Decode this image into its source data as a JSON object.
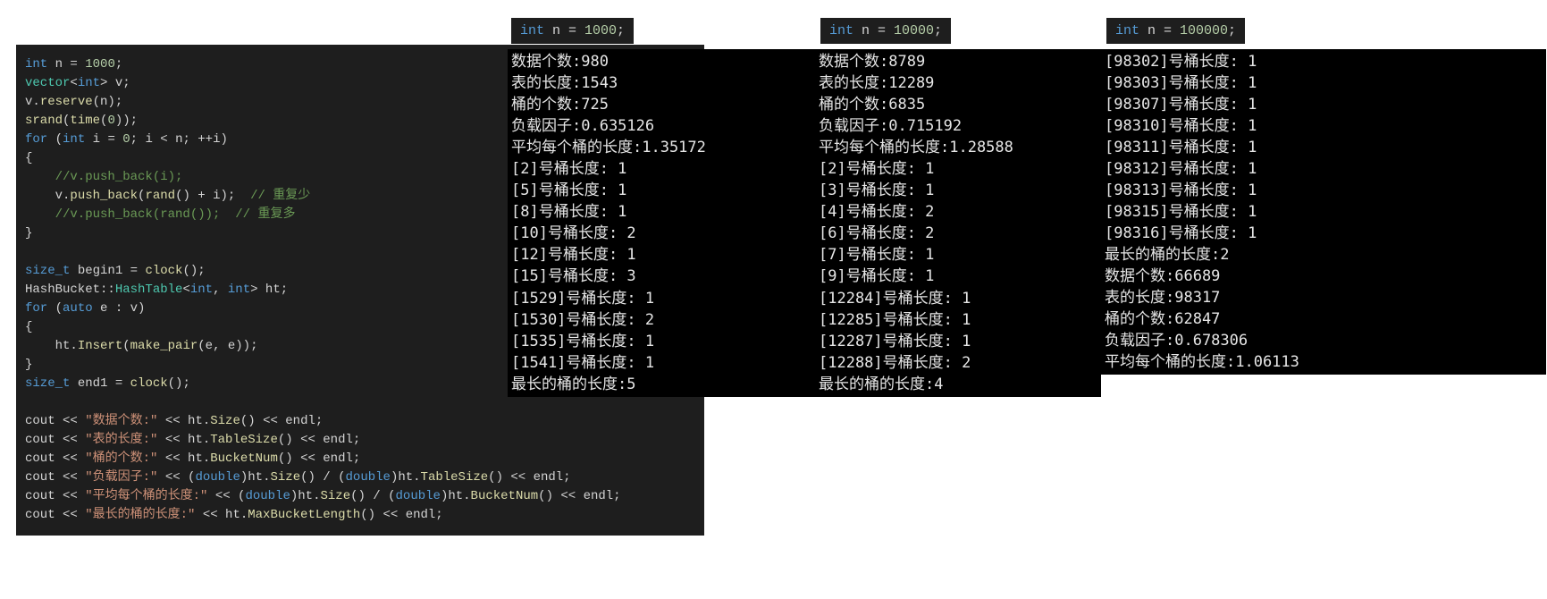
{
  "code": {
    "l1_kw": "int",
    "l1_rest": " n = ",
    "l1_num": "1000",
    "l1_semi": ";",
    "l2_a": "vector",
    "l2_b": "<",
    "l2_c": "int",
    "l2_d": "> v;",
    "l3": "v.reserve(n);",
    "l3_v": "v",
    "l3_dot": ".",
    "l3_fn": "reserve",
    "l3_args": "(n);",
    "l4_fn": "srand",
    "l4_args": "(",
    "l4_fn2": "time",
    "l4_args2": "(",
    "l4_num": "0",
    "l4_end": "));",
    "l5_for": "for",
    "l5_a": " (",
    "l5_int": "int",
    "l5_b": " i = ",
    "l5_z": "0",
    "l5_c": "; i < n; ++i)",
    "l6": "{",
    "l7_cm": "    //v.push_back(i);",
    "l8_a": "    v.",
    "l8_fn": "push_back",
    "l8_b": "(",
    "l8_fn2": "rand",
    "l8_c": "() + i);  ",
    "l8_cm": "// 重复少",
    "l9_cm": "    //v.push_back(rand());  // 重复多",
    "l10": "}",
    "l12_t": "size_t",
    "l12_a": " begin1 = ",
    "l12_fn": "clock",
    "l12_b": "();",
    "l13_a": "HashBucket::",
    "l13_t": "HashTable",
    "l13_b": "<",
    "l13_int1": "int",
    "l13_c": ", ",
    "l13_int2": "int",
    "l13_d": "> ht;",
    "l14_for": "for",
    "l14_a": " (",
    "l14_auto": "auto",
    "l14_b": " e : v)",
    "l15": "{",
    "l16_a": "    ht.",
    "l16_fn": "Insert",
    "l16_b": "(",
    "l16_fn2": "make_pair",
    "l16_c": "(e, e));",
    "l17": "}",
    "l18_t": "size_t",
    "l18_a": " end1 = ",
    "l18_fn": "clock",
    "l18_b": "();",
    "l20_a": "cout << ",
    "l20_s": "\"数据个数:\"",
    "l20_b": " << ht.",
    "l20_fn": "Size",
    "l20_c": "() << endl;",
    "l21_a": "cout << ",
    "l21_s": "\"表的长度:\"",
    "l21_b": " << ht.",
    "l21_fn": "TableSize",
    "l21_c": "() << endl;",
    "l22_a": "cout << ",
    "l22_s": "\"桶的个数:\"",
    "l22_b": " << ht.",
    "l22_fn": "BucketNum",
    "l22_c": "() << endl;",
    "l23_a": "cout << ",
    "l23_s": "\"负载因子:\"",
    "l23_b": " << (",
    "l23_kw1": "double",
    "l23_c": ")ht.",
    "l23_fn1": "Size",
    "l23_d": "() / (",
    "l23_kw2": "double",
    "l23_e": ")ht.",
    "l23_fn2": "TableSize",
    "l23_f": "() << endl;",
    "l24_a": "cout << ",
    "l24_s": "\"平均每个桶的长度:\"",
    "l24_b": " << (",
    "l24_kw1": "double",
    "l24_c": ")ht.",
    "l24_fn1": "Size",
    "l24_d": "() / (",
    "l24_kw2": "double",
    "l24_e": ")ht.",
    "l24_fn2": "BucketNum",
    "l24_f": "() << endl;",
    "l25_a": "cout << ",
    "l25_s": "\"最长的桶的长度:\"",
    "l25_b": " << ht.",
    "l25_fn": "MaxBucketLength",
    "l25_c": "() << endl;"
  },
  "headers": {
    "h1_kw": "int",
    "h1_rest": " n = ",
    "h1_num": "1000",
    "h1_semi": ";",
    "h2_kw": "int",
    "h2_rest": " n = ",
    "h2_num": "10000",
    "h2_semi": ";",
    "h3_kw": "int",
    "h3_rest": " n = ",
    "h3_num": "100000",
    "h3_semi": ";"
  },
  "console1a": "数据个数:980\n表的长度:1543\n桶的个数:725\n负载因子:0.635126\n平均每个桶的长度:1.35172\n[2]号桶长度: 1\n[5]号桶长度: 1\n[8]号桶长度: 1\n[10]号桶长度: 2\n[12]号桶长度: 1\n[15]号桶长度: 3",
  "console1b": "[1529]号桶长度: 1\n[1530]号桶长度: 2\n[1535]号桶长度: 1\n[1541]号桶长度: 1\n最长的桶的长度:5",
  "console2a": "数据个数:8789\n表的长度:12289\n桶的个数:6835\n负载因子:0.715192\n平均每个桶的长度:1.28588\n[2]号桶长度: 1\n[3]号桶长度: 1\n[4]号桶长度: 2\n[6]号桶长度: 2\n[7]号桶长度: 1\n[9]号桶长度: 1",
  "console2b": "[12284]号桶长度: 1\n[12285]号桶长度: 1\n[12287]号桶长度: 1\n[12288]号桶长度: 2\n最长的桶的长度:4",
  "console3": "[98302]号桶长度: 1\n[98303]号桶长度: 1\n[98307]号桶长度: 1\n[98310]号桶长度: 1\n[98311]号桶长度: 1\n[98312]号桶长度: 1\n[98313]号桶长度: 1\n[98315]号桶长度: 1\n[98316]号桶长度: 1\n最长的桶的长度:2\n数据个数:66689\n表的长度:98317\n桶的个数:62847\n负载因子:0.678306\n平均每个桶的长度:1.06113"
}
